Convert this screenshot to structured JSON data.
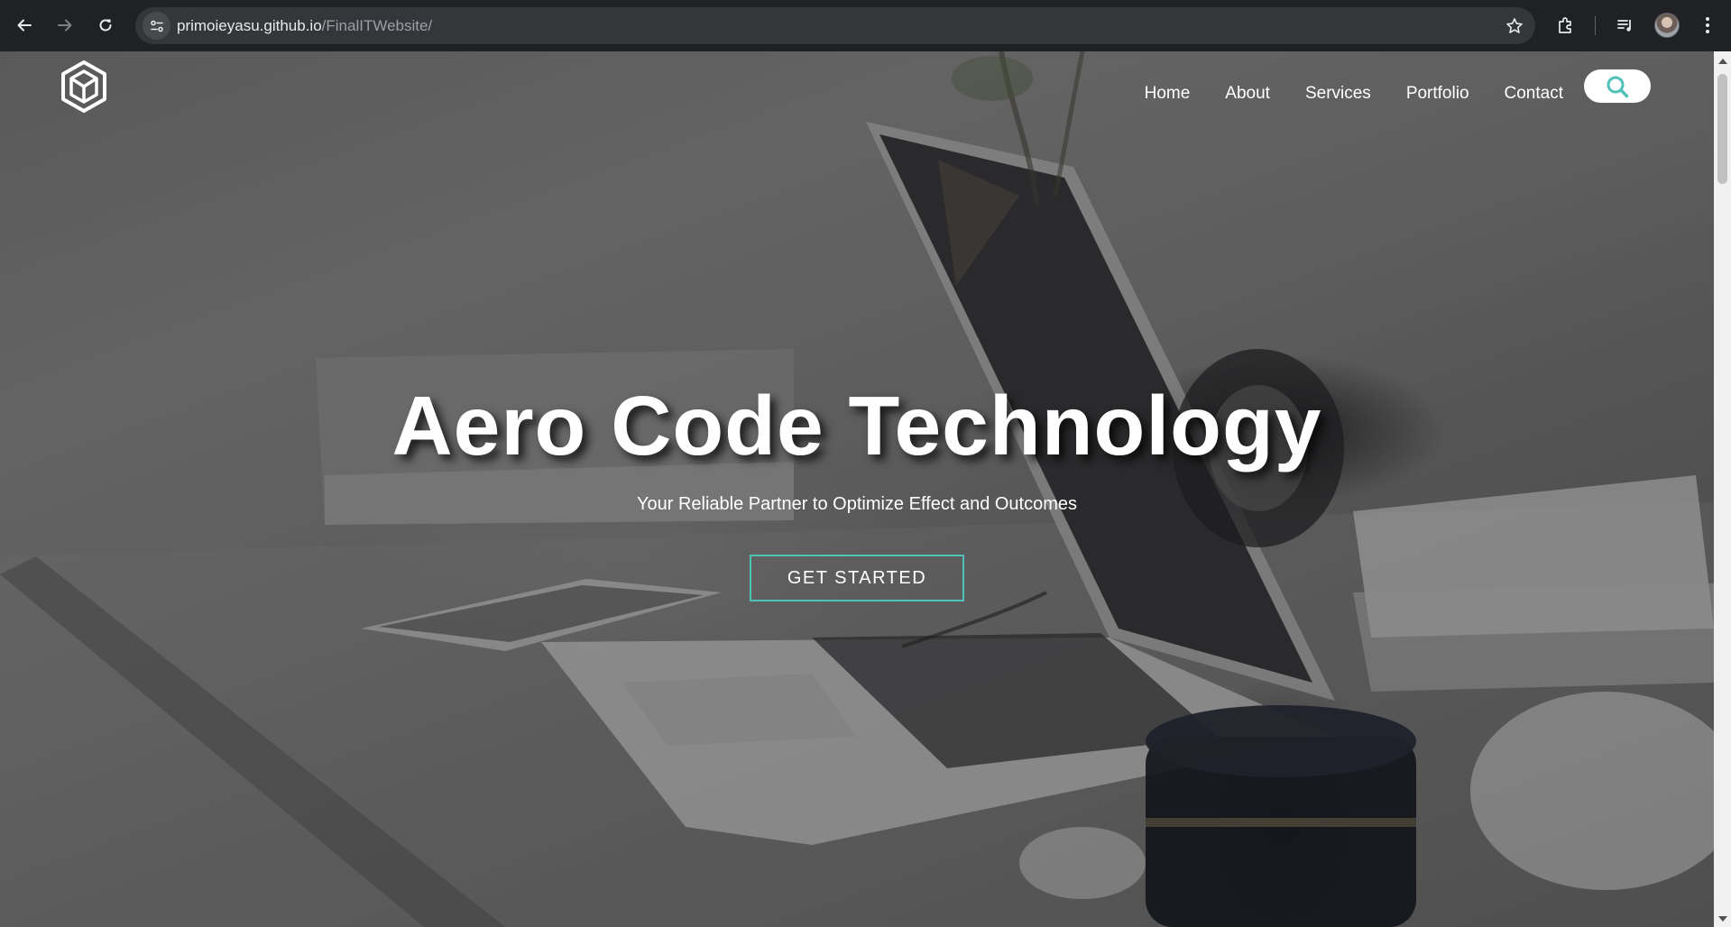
{
  "browser": {
    "url_host": "primoieyasu.github.io",
    "url_path": "/FinalITWebsite/",
    "icons": [
      "back-icon",
      "forward-icon",
      "reload-icon",
      "site-info-icon",
      "bookmark-star-icon",
      "extensions-icon",
      "media-controls-icon",
      "profile-avatar",
      "more-menu-icon"
    ]
  },
  "site": {
    "nav": {
      "items": [
        "Home",
        "About",
        "Services",
        "Portfolio",
        "Contact"
      ]
    },
    "search": {
      "icon": "search-icon"
    },
    "hero": {
      "title": "Aero Code Technology",
      "subtitle": "Your Reliable Partner to Optimize Effect and Outcomes",
      "cta_label": "GET STARTED"
    },
    "colors": {
      "accent": "#4fc1b8",
      "text": "#ffffff",
      "chrome_bg": "#202124"
    }
  }
}
